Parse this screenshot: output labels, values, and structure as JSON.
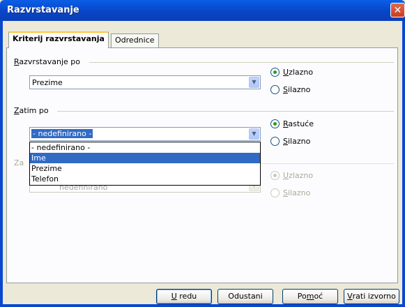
{
  "window": {
    "title": "Razvrstavanje",
    "close_glyph": "✕"
  },
  "tabs": [
    {
      "label": "Kriterij razvrstavanja",
      "active": true
    },
    {
      "label": "Odrednice",
      "active": false
    }
  ],
  "sort_key_1": {
    "label_u": "R",
    "label_rest": "azvrstavanje po",
    "value": "Prezime",
    "radios": [
      {
        "u": "U",
        "rest": "zlazno",
        "checked": true
      },
      {
        "u": "S",
        "rest": "ilazno",
        "checked": false
      }
    ]
  },
  "sort_key_2": {
    "label_u": "Z",
    "label_rest": "atim po",
    "value": "- nedefinirano -",
    "radios": [
      {
        "u": "R",
        "rest": "astuće",
        "checked": true
      },
      {
        "u": "S",
        "rest": "ilazno",
        "checked": false
      }
    ],
    "dropdown_options": [
      "- nedefinirano -",
      "Ime",
      "Prezime",
      "Telefon"
    ],
    "highlighted_option": "Ime"
  },
  "sort_key_3": {
    "label_visible": "Za",
    "value_fragment": "nedefinirano",
    "radios": [
      {
        "u": "U",
        "rest": "zlazno",
        "checked": true
      },
      {
        "u": "S",
        "rest": "ilazno",
        "checked": false
      }
    ]
  },
  "buttons": {
    "ok": {
      "u": "U",
      "rest": " redu"
    },
    "cancel": "Odustani",
    "help": {
      "pre": "Po",
      "u": "m",
      "rest": "oć"
    },
    "reset": {
      "u": "V",
      "rest": "rati izvorno"
    }
  },
  "icons": {
    "combo_arrow": "▼"
  }
}
